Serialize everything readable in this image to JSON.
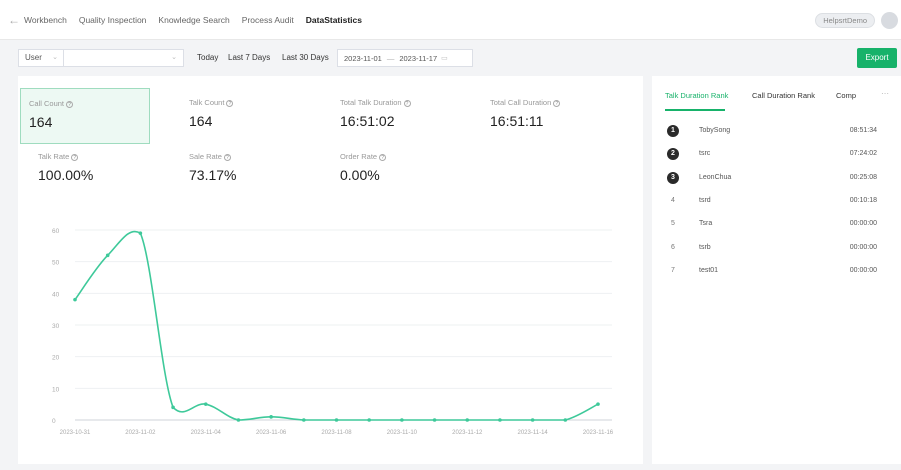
{
  "nav": {
    "tabs": [
      "Workbench",
      "Quality Inspection",
      "Knowledge Search",
      "Process Audit",
      "DataStatistics"
    ],
    "active_index": 4,
    "user": "HelpsrtDemo"
  },
  "filter": {
    "dimension": "User",
    "quick_ranges": [
      "Today",
      "Last 7 Days",
      "Last 30 Days"
    ],
    "date_start": "2023-11-01",
    "date_end": "2023-11-17",
    "export_label": "Export"
  },
  "stats": [
    {
      "label": "Call Count",
      "value": "164",
      "selected": true
    },
    {
      "label": "Talk Count",
      "value": "164"
    },
    {
      "label": "Total Talk Duration",
      "value": "16:51:02"
    },
    {
      "label": "Total Call Duration",
      "value": "16:51:11"
    },
    {
      "label": "Talk Rate",
      "value": "100.00%"
    },
    {
      "label": "Sale Rate",
      "value": "73.17%"
    },
    {
      "label": "Order Rate",
      "value": "0.00%"
    }
  ],
  "chart_data": {
    "type": "line",
    "x": [
      "2023-10-31",
      "2023-11-01",
      "2023-11-02",
      "2023-11-03",
      "2023-11-04",
      "2023-11-05",
      "2023-11-06",
      "2023-11-07",
      "2023-11-08",
      "2023-11-09",
      "2023-11-10",
      "2023-11-11",
      "2023-11-12",
      "2023-11-13",
      "2023-11-14",
      "2023-11-15",
      "2023-11-16"
    ],
    "x_tick_labels": [
      "2023-10-31",
      "2023-11-02",
      "2023-11-04",
      "2023-11-06",
      "2023-11-08",
      "2023-11-10",
      "2023-11-12",
      "2023-11-14",
      "2023-11-16"
    ],
    "series": [
      {
        "values": [
          38,
          52,
          59,
          4,
          5,
          0,
          1,
          0,
          0,
          0,
          0,
          0,
          0,
          0,
          0,
          0,
          5
        ]
      }
    ],
    "ylim": [
      0,
      60
    ],
    "y_ticks": [
      0,
      10,
      20,
      30,
      40,
      50,
      60
    ],
    "grid": true,
    "color": "#3ec99a"
  },
  "ranking": {
    "tabs": [
      "Talk Duration Rank",
      "Call Duration Rank",
      "Comp"
    ],
    "more": "⋯",
    "rows": [
      {
        "rank": "1",
        "name": "TobySong",
        "time": "08:51:34"
      },
      {
        "rank": "2",
        "name": "tsrc",
        "time": "07:24:02"
      },
      {
        "rank": "3",
        "name": "LeonChua",
        "time": "00:25:08"
      },
      {
        "rank": "4",
        "name": "tsrd",
        "time": "00:10:18"
      },
      {
        "rank": "5",
        "name": "Tsra",
        "time": "00:00:00"
      },
      {
        "rank": "6",
        "name": "tsrb",
        "time": "00:00:00"
      },
      {
        "rank": "7",
        "name": "test01",
        "time": "00:00:00"
      }
    ]
  },
  "colors": {
    "accent": "#17b26a",
    "line": "#3ec99a"
  }
}
